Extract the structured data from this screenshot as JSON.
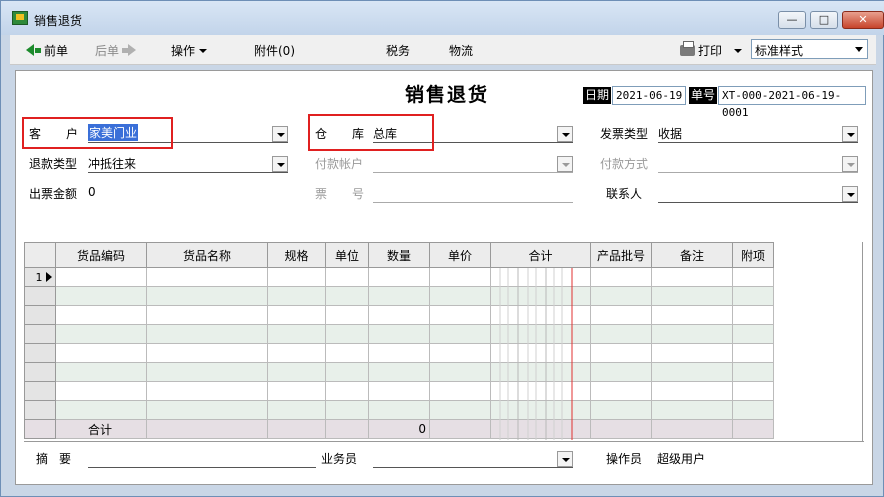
{
  "window": {
    "title": "销售退货",
    "minimize": "—",
    "maximize": "□",
    "close": "✕"
  },
  "toolbar": {
    "prev": "前单",
    "next": "后单",
    "actions": "操作",
    "attachments": "附件(0)",
    "tax": "税务",
    "logistics": "物流",
    "print": "打印",
    "print_style": "标准样式"
  },
  "form": {
    "title": "销售退货",
    "date_label": "日期",
    "date_value": "2021-06-19",
    "doc_no_label": "单号",
    "doc_no_value": "XT-000-2021-06-19-0001",
    "customer_label_1": "客",
    "customer_label_2": "户",
    "customer_value": "家美门业",
    "warehouse_label_1": "仓",
    "warehouse_label_2": "库",
    "warehouse_value": "总库",
    "invoice_type_label": "发票类型",
    "invoice_type_value": "收据",
    "refund_type_label": "退款类型",
    "refund_type_value": "冲抵往来",
    "pay_account_label": "付款帐户",
    "pay_method_label": "付款方式",
    "invoice_amount_label": "出票金额",
    "invoice_amount_value": "0",
    "ticket_no_label_1": "票",
    "ticket_no_label_2": "号",
    "contact_label": "联系人"
  },
  "grid": {
    "columns": [
      "货品编码",
      "货品名称",
      "规格",
      "单位",
      "数量",
      "单价",
      "合计",
      "产品批号",
      "备注",
      "附项"
    ],
    "first_row_no": "1",
    "sum_label": "合计",
    "sum_qty": "0"
  },
  "footer": {
    "summary_label_1": "摘",
    "summary_label_2": "要",
    "salesman_label": "业务员",
    "operator_label": "操作员",
    "operator_value": "超级用户"
  },
  "colors": {
    "highlight_box": "#e02020",
    "selection": "#3a6fd8"
  }
}
